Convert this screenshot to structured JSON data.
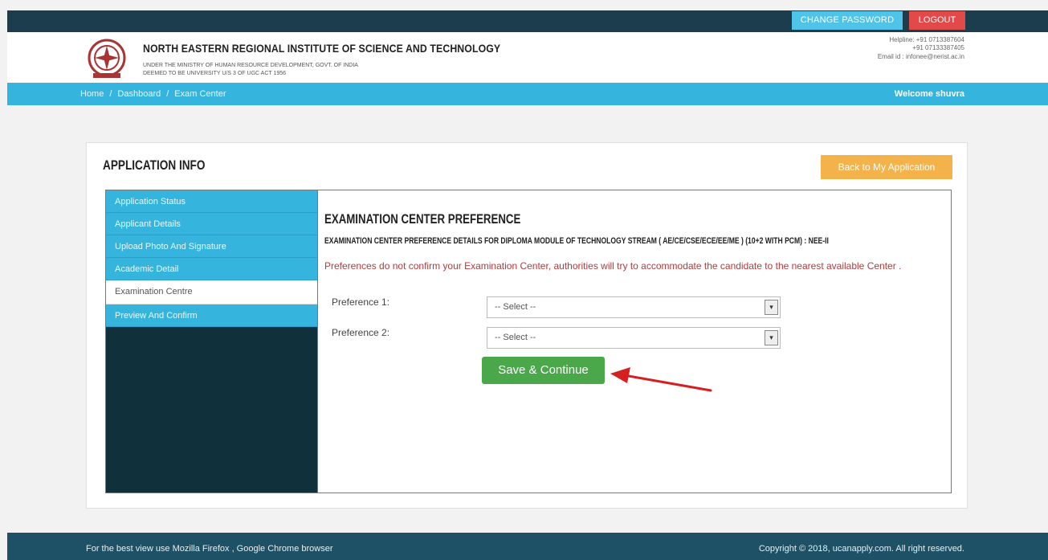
{
  "topbar": {
    "change_password": "CHANGE PASSWORD",
    "logout": "LOGOUT"
  },
  "header": {
    "institute": "NORTH EASTERN REGIONAL INSTITUTE OF SCIENCE AND TECHNOLOGY",
    "sub1": "UNDER THE MINISTRY OF HUMAN RESOURCE DEVELOPMENT, GOVT. OF INDIA",
    "sub2": "DEEMED TO BE UNIVERSITY U/S 3 OF UGC ACT 1956",
    "helpline1": "Helpline: +91 0713387604",
    "helpline2": "+91 07133387405",
    "email": "Email id : infonee@nerist.ac.in"
  },
  "breadcrumb": {
    "home": "Home",
    "sep": "/",
    "dashboard": "Dashboard",
    "current": "Exam Center"
  },
  "welcome": "Welcome shuvra",
  "panel": {
    "title": "APPLICATION INFO",
    "back_button": "Back to My Application"
  },
  "sidebar": {
    "items": [
      {
        "label": "Application Status"
      },
      {
        "label": "Applicant Details"
      },
      {
        "label": "Upload Photo And Signature"
      },
      {
        "label": "Academic Detail"
      },
      {
        "label": "Examination Centre"
      },
      {
        "label": "Preview And Confirm"
      }
    ]
  },
  "main": {
    "title": "EXAMINATION CENTER PREFERENCE",
    "subtitle": "EXAMINATION CENTER PREFERENCE DETAILS FOR DIPLOMA MODULE OF TECHNOLOGY STREAM ( AE/CE/CSE/ECE/EE/ME ) (10+2 WITH PCM) : NEE-II",
    "warning": "Preferences do not confirm your Examination Center, authorities will try to accommodate the candidate to the nearest available Center .",
    "pref1_label": "Preference 1:",
    "pref1_value": "-- Select --",
    "pref2_label": "Preference 2:",
    "pref2_value": "-- Select --",
    "save_button": "Save & Continue"
  },
  "footer": {
    "left": "For the best view use Mozilla Firefox , Google Chrome browser",
    "right": "Copyright © 2018, ucanapply.com. All right reserved."
  },
  "colors": {
    "topbar": "#1b3d4e",
    "accent": "#35b4de",
    "save": "#4aa84a",
    "back": "#f3b24a",
    "logout": "#e24a4a",
    "sidebar": "#10303c"
  },
  "icons": {
    "logo": "institute-emblem-logo",
    "arrow": "red-arrow-annotation"
  }
}
